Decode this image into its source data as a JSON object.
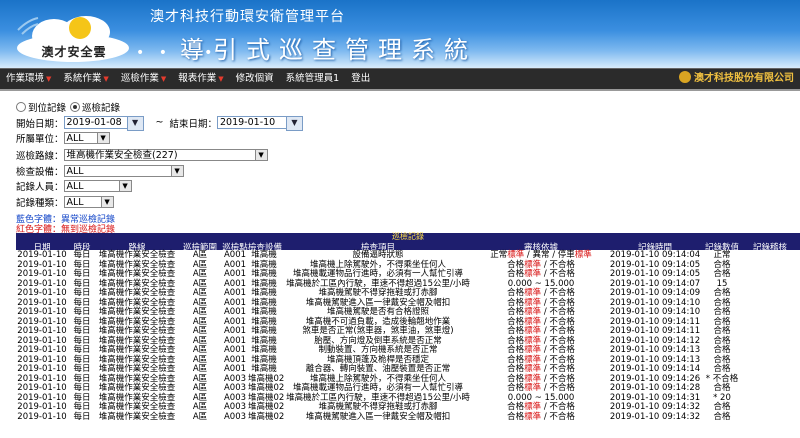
{
  "header": {
    "logo_text": "澳才安全雲",
    "org_name": "澳才科技行動環安衛管理平台",
    "system_title": "導引式巡查管理系統",
    "dots": "• • • •"
  },
  "nav": {
    "items": [
      {
        "label": "作業環境",
        "dropdown": true
      },
      {
        "label": "系統作業",
        "dropdown": true
      },
      {
        "label": "巡檢作業",
        "dropdown": true
      },
      {
        "label": "報表作業",
        "dropdown": true
      },
      {
        "label": "修改個資",
        "dropdown": false
      },
      {
        "label": "系統管理員1",
        "dropdown": false
      },
      {
        "label": "登出",
        "dropdown": false
      }
    ],
    "company": "澳才科技股份有限公司"
  },
  "form": {
    "radio1": "到位記錄",
    "radio2": "巡檢記錄",
    "start_label": "開始日期：",
    "start_date": "2019-01-08",
    "tilde": "~",
    "end_label": "結束日期：",
    "end_date": "2019-01-10",
    "dept_label": "所屬單位：",
    "dept_value": "ALL",
    "route_label": "巡檢路線：",
    "route_value": "堆高機作業安全檢查(227)",
    "equip_label": "檢查設備：",
    "equip_value": "ALL",
    "person_label": "記錄人員：",
    "person_value": "ALL",
    "type_label": "記錄種類：",
    "type_value": "ALL"
  },
  "legend": {
    "blue": "藍色字體：異常巡檢記錄",
    "red": "紅色字體：無到巡檢記錄"
  },
  "table": {
    "title": "巡檢記錄",
    "columns": [
      "日期",
      "時段",
      "路線",
      "巡檢範圍",
      "巡檢點",
      "檢查設備",
      "檢查項目",
      "審核依據",
      "記錄時間",
      "記錄數值",
      "記錄稽核"
    ],
    "rows": [
      [
        "2019-01-10",
        "每日",
        "堆高機作業安全檢查",
        "A區",
        "A001",
        "堆高機",
        "設備逼時狀態",
        "正常標準 / 異常 / 停車標準",
        "2019-01-10 09:14:04",
        "正常",
        ""
      ],
      [
        "2019-01-10",
        "每日",
        "堆高機作業安全檢查",
        "A區",
        "A001",
        "堆高機",
        "堆高機上除駕駛外，不得乘坐任何人",
        "合格標準 / 不合格",
        "2019-01-10 09:14:05",
        "合格",
        ""
      ],
      [
        "2019-01-10",
        "每日",
        "堆高機作業安全檢查",
        "A區",
        "A001",
        "堆高機",
        "堆高機載運物品行進時，必須有一人幫忙引導",
        "合格標準 / 不合格",
        "2019-01-10 09:14:05",
        "合格",
        ""
      ],
      [
        "2019-01-10",
        "每日",
        "堆高機作業安全檢查",
        "A區",
        "A001",
        "堆高機",
        "堆高機於工區內行駛，車速不得超過15公里/小時",
        "0.000 ~ 15.000",
        "2019-01-10 09:14:07",
        "15",
        ""
      ],
      [
        "2019-01-10",
        "每日",
        "堆高機作業安全檢查",
        "A區",
        "A001",
        "堆高機",
        "堆高機駕駛不得穿拖鞋或打赤腳",
        "合格標準 / 不合格",
        "2019-01-10 09:14:09",
        "合格",
        ""
      ],
      [
        "2019-01-10",
        "每日",
        "堆高機作業安全檢查",
        "A區",
        "A001",
        "堆高機",
        "堆高機駕駛進入區一律戴安全帽及帽扣",
        "合格標準 / 不合格",
        "2019-01-10 09:14:10",
        "合格",
        ""
      ],
      [
        "2019-01-10",
        "每日",
        "堆高機作業安全檢查",
        "A區",
        "A001",
        "堆高機",
        "堆高機駕駛是否有合格證照",
        "合格標準 / 不合格",
        "2019-01-10 09:14:10",
        "合格",
        ""
      ],
      [
        "2019-01-10",
        "每日",
        "堆高機作業安全檢查",
        "A區",
        "A001",
        "堆高機",
        "堆高機不可過負載，造成後輪翹地作業",
        "合格標準 / 不合格",
        "2019-01-10 09:14:11",
        "合格",
        ""
      ],
      [
        "2019-01-10",
        "每日",
        "堆高機作業安全檢查",
        "A區",
        "A001",
        "堆高機",
        "煞車是否正常(煞車器，煞車油，煞車燈)",
        "合格標準 / 不合格",
        "2019-01-10 09:14:11",
        "合格",
        ""
      ],
      [
        "2019-01-10",
        "每日",
        "堆高機作業安全檢查",
        "A區",
        "A001",
        "堆高機",
        "胎壓、方向燈及倒車系統是否正常",
        "合格標準 / 不合格",
        "2019-01-10 09:14:12",
        "合格",
        ""
      ],
      [
        "2019-01-10",
        "每日",
        "堆高機作業安全檢查",
        "A區",
        "A001",
        "堆高機",
        "制動裝置、方向機系統是否正常",
        "合格標準 / 不合格",
        "2019-01-10 09:14:13",
        "合格",
        ""
      ],
      [
        "2019-01-10",
        "每日",
        "堆高機作業安全檢查",
        "A區",
        "A001",
        "堆高機",
        "堆高機頂蓬及桅桿是否穩定",
        "合格標準 / 不合格",
        "2019-01-10 09:14:13",
        "合格",
        ""
      ],
      [
        "2019-01-10",
        "每日",
        "堆高機作業安全檢查",
        "A區",
        "A001",
        "堆高機",
        "離合器、轉向裝置、油壓裝置是否正常",
        "合格標準 / 不合格",
        "2019-01-10 09:14:14",
        "合格",
        ""
      ],
      [
        "2019-01-10",
        "每日",
        "堆高機作業安全檢查",
        "A區",
        "A003",
        "堆高機02",
        "堆高機上除駕駛外，不得乘坐任何人",
        "合格標準 / 不合格",
        "2019-01-10 09:14:26",
        "* 不合格",
        ""
      ],
      [
        "2019-01-10",
        "每日",
        "堆高機作業安全檢查",
        "A區",
        "A003",
        "堆高機02",
        "堆高機載運物品行進時，必須有一人幫忙引導",
        "合格標準 / 不合格",
        "2019-01-10 09:14:28",
        "合格",
        ""
      ],
      [
        "2019-01-10",
        "每日",
        "堆高機作業安全檢查",
        "A區",
        "A003",
        "堆高機02",
        "堆高機於工區內行駛，車速不得超過15公里/小時",
        "0.000 ~ 15.000",
        "2019-01-10 09:14:31",
        "* 20",
        ""
      ],
      [
        "2019-01-10",
        "每日",
        "堆高機作業安全檢查",
        "A區",
        "A003",
        "堆高機02",
        "堆高機駕駛不得穿拖鞋或打赤腳",
        "合格標準 / 不合格",
        "2019-01-10 09:14:32",
        "合格",
        ""
      ],
      [
        "2019-01-10",
        "每日",
        "堆高機作業安全檢查",
        "A區",
        "A003",
        "堆高機02",
        "堆高機駕駛進入區一律戴安全帽及帽扣",
        "合格標準 / 不合格",
        "2019-01-10 09:14:32",
        "合格",
        ""
      ]
    ]
  },
  "colors": {
    "nav_bg": "#2b2b2b",
    "table_header_bg": "#1e1e6e",
    "blue_text": "#1346c8",
    "red_text": "#d81414"
  }
}
